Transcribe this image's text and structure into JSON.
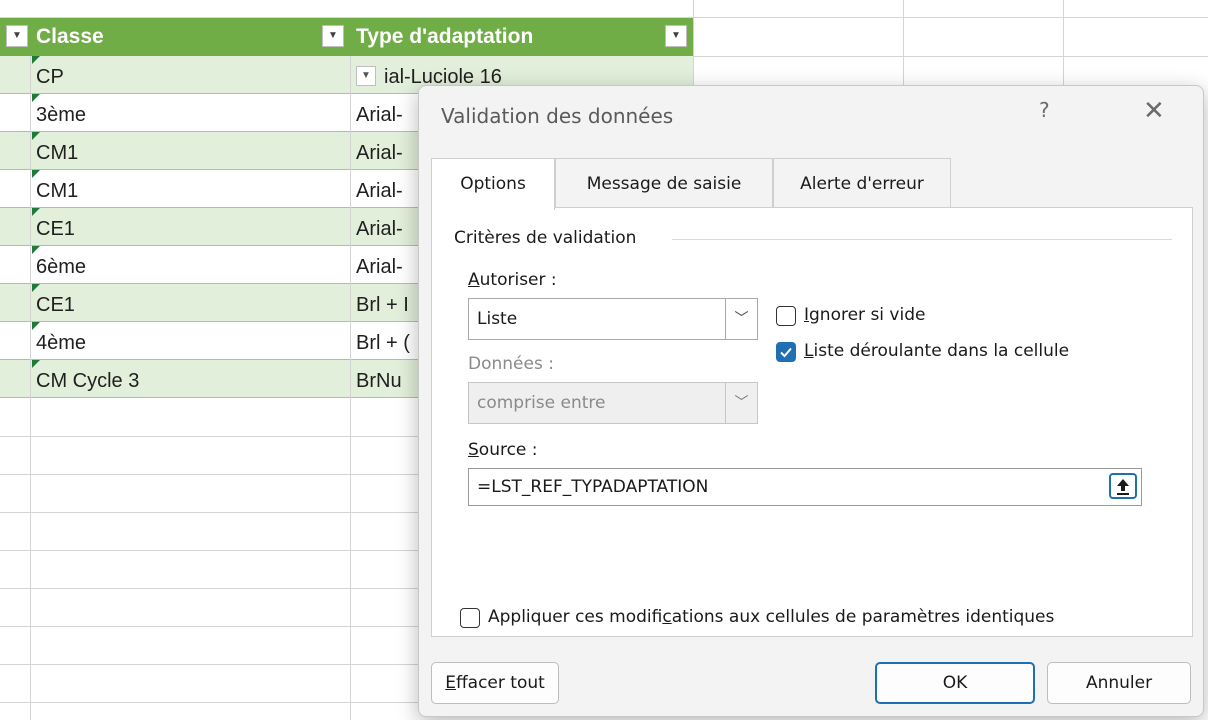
{
  "sheet": {
    "headers": [
      "Classe",
      "Type d'adaptation"
    ],
    "header_filter_icon": "filter-dropdown-icon",
    "rows": [
      {
        "classe": "CP",
        "type": "ial-Luciole 16"
      },
      {
        "classe": "3ème",
        "type": "Arial-"
      },
      {
        "classe": "CM1",
        "type": "Arial-"
      },
      {
        "classe": "CM1",
        "type": "Arial-"
      },
      {
        "classe": "CE1",
        "type": "Arial-"
      },
      {
        "classe": "6ème",
        "type": "Arial-"
      },
      {
        "classe": "CE1",
        "type": "Brl + I"
      },
      {
        "classe": "4ème",
        "type": "Brl + ("
      },
      {
        "classe": "CM Cycle 3",
        "type": "BrNu"
      }
    ],
    "colors": {
      "header": "#70ad47",
      "band": "#e2efda"
    }
  },
  "dialog": {
    "title": "Validation des données",
    "help": "?",
    "close": "✕",
    "tabs": [
      {
        "label": "Options",
        "active": true
      },
      {
        "label": "Message de saisie",
        "active": false
      },
      {
        "label": "Alerte d'erreur",
        "active": false
      }
    ],
    "group_label": "Critères de validation",
    "allow": {
      "label_u": "A",
      "label_rest": "utoriser :",
      "value": "Liste"
    },
    "data": {
      "label": "Données :",
      "value": "comprise entre"
    },
    "ignore_blank": {
      "label_u": "I",
      "label_rest": "gnorer si vide",
      "checked": false
    },
    "in_cell_dropdown": {
      "label_u": "L",
      "label_rest": "iste déroulante dans la cellule",
      "checked": true
    },
    "source": {
      "label_u": "S",
      "label_rest": "ource :",
      "value": "=LST_REF_TYPADAPTATION"
    },
    "apply_all": {
      "label_pre": "Appliquer ces modifi",
      "label_u": "c",
      "label_post": "ations aux cellules de paramètres identiques",
      "checked": false
    },
    "buttons": {
      "clear_u": "E",
      "clear_rest": "ffacer tout",
      "ok": "OK",
      "cancel": "Annuler"
    },
    "accent": "#1f6fb5"
  }
}
